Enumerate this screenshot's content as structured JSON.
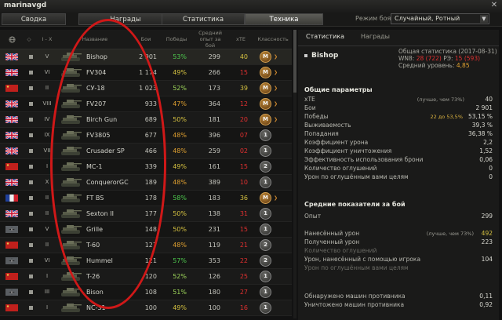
{
  "window": {
    "username": "marinavgd"
  },
  "tabs": [
    "Сводка",
    "Награды",
    "Статистика",
    "Техника"
  ],
  "mode": {
    "label": "Режим боя:",
    "value": "Случайный, Ротный"
  },
  "table_headers": {
    "tier": "I - X",
    "name": "Название",
    "battles": "Бои",
    "wins": "Победы",
    "avgexp": "Средний опыт за бой",
    "xte": "xTE",
    "mastery": "Классность"
  },
  "rows": [
    {
      "flag": "uk",
      "tier": "V",
      "name": "Bishop",
      "battles": "2 901",
      "wins": "53%",
      "wins_color": "#4ec84e",
      "avgexp": "299",
      "xte": "40",
      "xte_color": "#d4c040",
      "badge": "M",
      "gold": true,
      "arrow": true
    },
    {
      "flag": "uk",
      "tier": "VI",
      "name": "FV304",
      "battles": "1 174",
      "wins": "49%",
      "wins_color": "#d4c040",
      "avgexp": "266",
      "xte": "15",
      "xte_color": "#e03030",
      "badge": "M",
      "gold": true,
      "arrow": true
    },
    {
      "flag": "ussr",
      "tier": "II",
      "name": "СУ-18",
      "battles": "1 023",
      "wins": "52%",
      "wins_color": "#9ed65a",
      "avgexp": "173",
      "xte": "39",
      "xte_color": "#d4c040",
      "badge": "M",
      "gold": true,
      "arrow": true
    },
    {
      "flag": "uk",
      "tier": "VIII",
      "name": "FV207",
      "battles": "933",
      "wins": "47%",
      "wins_color": "#e0a030",
      "avgexp": "364",
      "xte": "12",
      "xte_color": "#e03030",
      "badge": "M",
      "gold": true,
      "arrow": true
    },
    {
      "flag": "uk",
      "tier": "IV",
      "name": "Birch Gun",
      "battles": "689",
      "wins": "50%",
      "wins_color": "#d4c040",
      "avgexp": "181",
      "xte": "20",
      "xte_color": "#e03030",
      "badge": "M",
      "gold": true,
      "arrow": true
    },
    {
      "flag": "uk",
      "tier": "IX",
      "name": "FV3805",
      "battles": "677",
      "wins": "48%",
      "wins_color": "#e0a030",
      "avgexp": "396",
      "xte": "07",
      "xte_color": "#e03030",
      "badge": "1",
      "gold": false,
      "arrow": false
    },
    {
      "flag": "uk",
      "tier": "VII",
      "name": "Crusader SP",
      "battles": "466",
      "wins": "48%",
      "wins_color": "#e0a030",
      "avgexp": "259",
      "xte": "02",
      "xte_color": "#e03030",
      "badge": "1",
      "gold": false,
      "arrow": false
    },
    {
      "flag": "ussr",
      "tier": "I",
      "name": "МС-1",
      "battles": "339",
      "wins": "49%",
      "wins_color": "#d4c040",
      "avgexp": "161",
      "xte": "15",
      "xte_color": "#e03030",
      "badge": "2",
      "gold": false,
      "arrow": false
    },
    {
      "flag": "uk",
      "tier": "X",
      "name": "ConquerorGC",
      "battles": "189",
      "wins": "48%",
      "wins_color": "#e0a030",
      "avgexp": "389",
      "xte": "10",
      "xte_color": "#e03030",
      "badge": "1",
      "gold": false,
      "arrow": false
    },
    {
      "flag": "fr",
      "tier": "II",
      "name": "FT BS",
      "battles": "178",
      "wins": "58%",
      "wins_color": "#4ec84e",
      "avgexp": "183",
      "xte": "36",
      "xte_color": "#d4c040",
      "badge": "M",
      "gold": true,
      "arrow": true
    },
    {
      "flag": "uk",
      "tier": "II",
      "name": "Sexton II",
      "battles": "177",
      "wins": "50%",
      "wins_color": "#d4c040",
      "avgexp": "138",
      "xte": "31",
      "xte_color": "#e03030",
      "badge": "1",
      "gold": false,
      "arrow": false
    },
    {
      "flag": "de",
      "tier": "V",
      "name": "Grille",
      "battles": "148",
      "wins": "50%",
      "wins_color": "#d4c040",
      "avgexp": "231",
      "xte": "15",
      "xte_color": "#e03030",
      "badge": "1",
      "gold": false,
      "arrow": false
    },
    {
      "flag": "ussr",
      "tier": "II",
      "name": "T-60",
      "battles": "127",
      "wins": "48%",
      "wins_color": "#e0a030",
      "avgexp": "119",
      "xte": "21",
      "xte_color": "#e03030",
      "badge": "2",
      "gold": false,
      "arrow": false
    },
    {
      "flag": "de",
      "tier": "VI",
      "name": "Hummel",
      "battles": "121",
      "wins": "57%",
      "wins_color": "#4ec84e",
      "avgexp": "353",
      "xte": "22",
      "xte_color": "#e03030",
      "badge": "2",
      "gold": false,
      "arrow": false
    },
    {
      "flag": "ussr",
      "tier": "I",
      "name": "T-26",
      "battles": "120",
      "wins": "52%",
      "wins_color": "#9ed65a",
      "avgexp": "126",
      "xte": "25",
      "xte_color": "#e03030",
      "badge": "1",
      "gold": false,
      "arrow": false
    },
    {
      "flag": "de",
      "tier": "III",
      "name": "Bison",
      "battles": "108",
      "wins": "51%",
      "wins_color": "#9ed65a",
      "avgexp": "180",
      "xte": "27",
      "xte_color": "#e03030",
      "badge": "1",
      "gold": false,
      "arrow": false
    },
    {
      "flag": "ussr",
      "tier": "I",
      "name": "NC-31",
      "battles": "100",
      "wins": "49%",
      "wins_color": "#d4c040",
      "avgexp": "100",
      "xte": "16",
      "xte_color": "#e03030",
      "badge": "1",
      "gold": false,
      "arrow": false
    }
  ],
  "right_panel": {
    "tabs": [
      "Статистика",
      "Награды"
    ],
    "vehicle_name": "Bishop",
    "stats_date": "Общая статистика (2017-08-31)",
    "wn8_label": "WN8:",
    "wn8_value": "28",
    "wn8_paren": "(722)",
    "rz_label": "РЭ:",
    "rz_value": "15",
    "rz_paren": "(593)",
    "avg_level_label": "Средний уровень:",
    "avg_level_value": "4,85",
    "general_title": "Общие параметры",
    "general": [
      {
        "label": "xTE",
        "note": "(лучше, чем 73%)",
        "value": "40"
      },
      {
        "label": "Бои",
        "value": "2 901"
      },
      {
        "label": "Победы",
        "note2": "22 до 53,5%",
        "value": "53,15 %"
      },
      {
        "label": "Выживаемость",
        "value": "39,3 %"
      },
      {
        "label": "Попадания",
        "value": "36,38 %"
      },
      {
        "label": "Коэффициент урона",
        "value": "2,2"
      },
      {
        "label": "Коэффициент уничтожения",
        "value": "1,52"
      },
      {
        "label": "Эффективность использования брони",
        "value": "0,06"
      },
      {
        "label": "Количество оглушений",
        "value": "0"
      },
      {
        "label": "Урон по оглушённым вами целям",
        "value": "0"
      }
    ],
    "avg_title": "Средние показатели за бой",
    "avg_exp_label": "Опыт",
    "avg_exp_value": "299",
    "avg": [
      {
        "label": "Нанесённый урон",
        "note": "(лучше, чем 73%)",
        "value": "492",
        "value_color": "#d4c040"
      },
      {
        "label": "Полученный урон",
        "value": "223"
      },
      {
        "label": "Количество оглушений",
        "value": "",
        "dim": true
      },
      {
        "label": "Урон, нанесённый с помощью игрока",
        "value": "104"
      },
      {
        "label": "Урон по оглушённым вами целям",
        "value": "",
        "dim": true
      }
    ],
    "spot": [
      {
        "label": "Обнаружено машин противника",
        "value": "0,11"
      },
      {
        "label": "Уничтожено машин противника",
        "value": "0,92"
      }
    ]
  }
}
